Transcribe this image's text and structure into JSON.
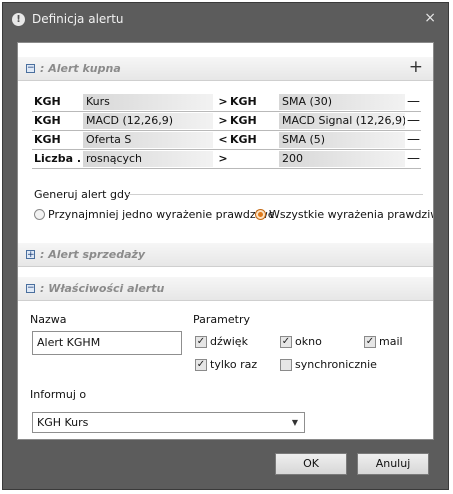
{
  "window": {
    "title": "Definicja alertu",
    "close": "×",
    "info_glyph": "!"
  },
  "sections": {
    "buy": {
      "toggle": "−",
      "title": ": Alert kupna",
      "add": "+"
    },
    "sell": {
      "toggle": "+",
      "title": ": Alert sprzedaży"
    },
    "props": {
      "toggle": "−",
      "title": ": Właściwości alertu"
    }
  },
  "conditions": [
    {
      "left_symbol": "KGH",
      "left_indicator": "Kurs",
      "operator": ">",
      "right_symbol": "KGH",
      "right_indicator": "SMA (30)",
      "remove": "—"
    },
    {
      "left_symbol": "KGH",
      "left_indicator": "MACD (12,26,9)",
      "operator": ">",
      "right_symbol": "KGH",
      "right_indicator": "MACD Signal (12,26,9)",
      "remove": "—"
    },
    {
      "left_symbol": "KGH",
      "left_indicator": "Oferta S",
      "operator": "<",
      "right_symbol": "KGH",
      "right_indicator": "SMA (5)",
      "remove": "—"
    },
    {
      "left_symbol": "Liczba ...",
      "left_indicator": "rosnących",
      "operator": ">",
      "right_symbol": "",
      "right_indicator": "200",
      "remove": "—"
    }
  ],
  "generate": {
    "label": "Generuj alert gdy",
    "options": [
      "Przynajmniej jedno wyrażenie prawdziwe",
      "Wszystkie wyrażenia prawdziwe"
    ],
    "selected": "Wszystkie wyrażenia prawdziwe"
  },
  "properties": {
    "name_label": "Nazwa",
    "name_value": "Alert KGHM",
    "params_label": "Parametry",
    "params": [
      {
        "label": "dźwięk",
        "checked": true
      },
      {
        "label": "okno",
        "checked": true
      },
      {
        "label": "mail",
        "checked": true
      },
      {
        "label": "tylko raz",
        "checked": true
      },
      {
        "label": "synchronicznie",
        "checked": false
      }
    ],
    "inform_label": "Informuj o",
    "inform_value": "KGH Kurs"
  },
  "buttons": {
    "ok": "OK",
    "cancel": "Anuluj"
  },
  "check_glyph": "✓",
  "colors": {
    "frame": "#5c5c5c",
    "radio_selected": "#e07a1a",
    "section_title": "#8b8b8b"
  }
}
